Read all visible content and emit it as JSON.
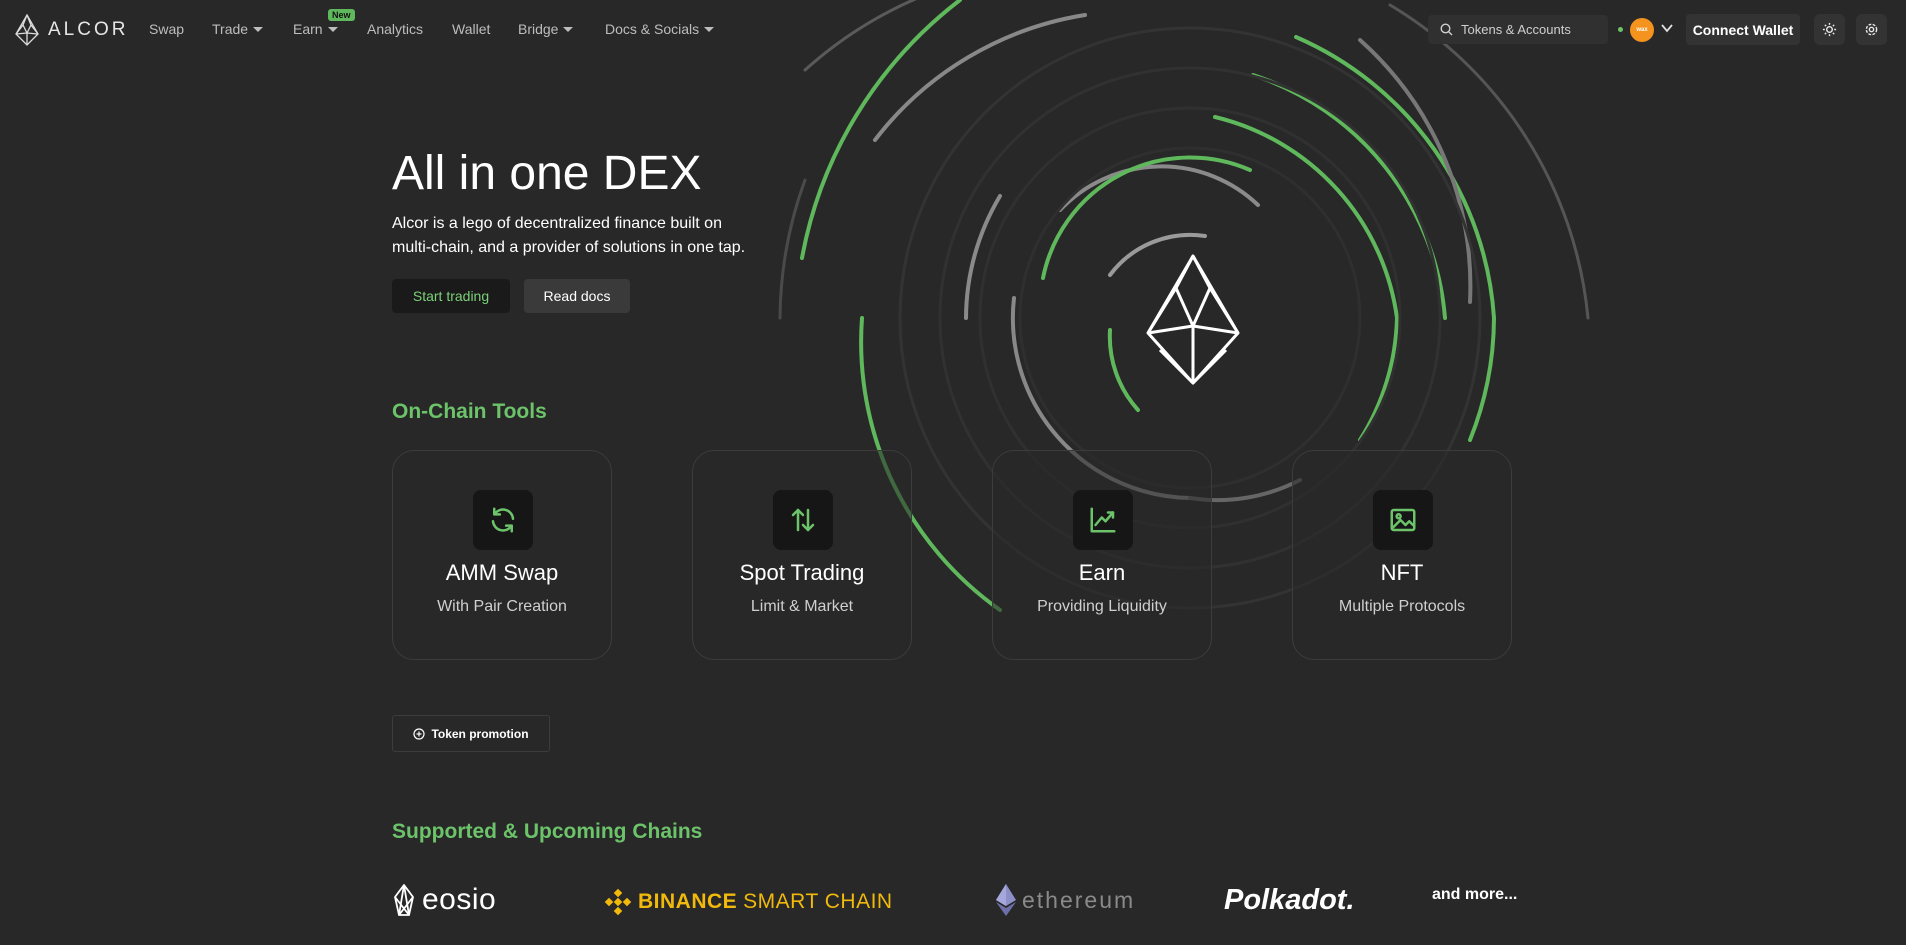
{
  "nav": {
    "logo_text": "ALCOR",
    "items": [
      {
        "label": "Swap"
      },
      {
        "label": "Trade"
      },
      {
        "label": "Earn",
        "badge": "New"
      },
      {
        "label": "Analytics"
      },
      {
        "label": "Wallet"
      },
      {
        "label": "Bridge"
      },
      {
        "label": "Docs & Socials"
      }
    ],
    "search_placeholder": "Tokens & Accounts",
    "network_badge": "wax",
    "connect_label": "Connect Wallet"
  },
  "hero": {
    "title": "All in one DEX",
    "subtitle": "Alcor is a lego of decentralized finance built on multi-chain, and a provider of solutions in one tap.",
    "start_label": "Start trading",
    "docs_label": "Read docs"
  },
  "tools": {
    "title": "On-Chain Tools",
    "cards": [
      {
        "title": "AMM Swap",
        "subtitle": "With Pair Creation",
        "icon": "refresh-icon"
      },
      {
        "title": "Spot Trading",
        "subtitle": "Limit & Market",
        "icon": "swap-vertical-icon"
      },
      {
        "title": "Earn",
        "subtitle": "Providing Liquidity",
        "icon": "chart-line-icon"
      },
      {
        "title": "NFT",
        "subtitle": "Multiple Protocols",
        "icon": "image-icon"
      }
    ]
  },
  "promo": {
    "label": "Token promotion"
  },
  "chains": {
    "title": "Supported & Upcoming Chains",
    "items": [
      {
        "name": "eosio"
      },
      {
        "name": "BINANCE",
        "name2": "SMART CHAIN"
      },
      {
        "name": "ethereum"
      },
      {
        "name": "Polkadot."
      }
    ],
    "more": "and more..."
  },
  "colors": {
    "background": "#282828",
    "accent_green": "#6cc36a",
    "binance_yellow": "#f0b90b"
  }
}
